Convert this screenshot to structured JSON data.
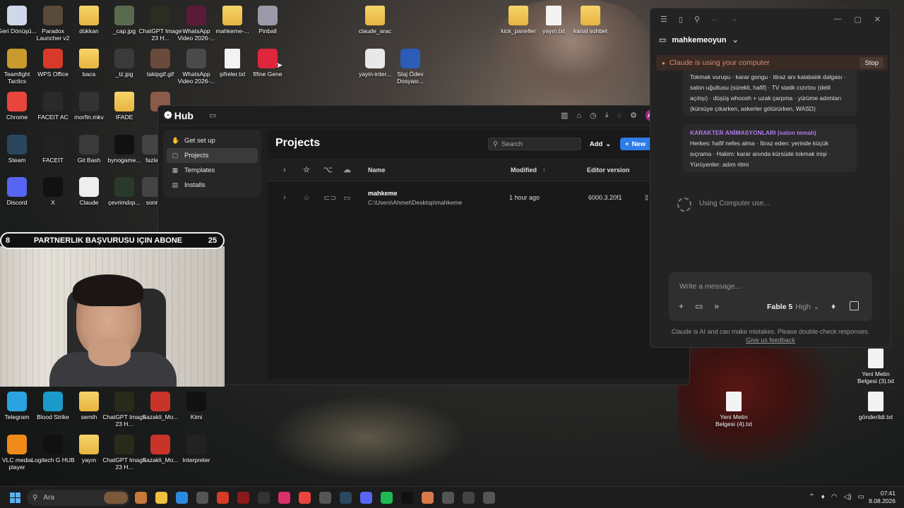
{
  "desktop_icons": [
    {
      "label": "Geri Dönüşü...",
      "icon": "recycle-bin-icon",
      "color": "#cfd8e8"
    },
    {
      "label": "Paradox Launcher v2",
      "icon": "paradox-icon",
      "color": "#5a4a3a"
    },
    {
      "label": "dükkan",
      "icon": "folder-icon",
      "color": "#f0c95a"
    },
    {
      "label": "_cap.jpg",
      "icon": "image-icon",
      "color": "#596b4f"
    },
    {
      "label": "ChatGPT Image 23 H...",
      "icon": "image-icon",
      "color": "#2d2d1f"
    },
    {
      "label": "WhatsApp Video 2026-...",
      "icon": "video-icon",
      "color": "#5a1b3a"
    },
    {
      "label": "mahkeme-...",
      "icon": "folder-icon",
      "color": "#f0c95a"
    },
    {
      "label": "Pinball",
      "icon": "pinball-icon",
      "color": "#9a9aa8"
    },
    {
      "label": "claude_arac",
      "icon": "folder-icon",
      "color": "#f0c95a"
    },
    {
      "label": "kick_paneller",
      "icon": "folder-icon",
      "color": "#f0c95a"
    },
    {
      "label": "yayın.txt",
      "icon": "text-file-icon",
      "color": "#eee"
    },
    {
      "label": "kanal sohbet",
      "icon": "folder-icon",
      "color": "#f0c95a"
    },
    {
      "label": "Teamfight Tactics",
      "icon": "tft-icon",
      "color": "#c89b2c"
    },
    {
      "label": "WPS Office",
      "icon": "wps-icon",
      "color": "#d83a2a"
    },
    {
      "label": "baca",
      "icon": "folder-icon",
      "color": "#f0c95a"
    },
    {
      "label": "_tz.jpg",
      "icon": "image-icon",
      "color": "#3a3a3a"
    },
    {
      "label": "takipgif.gif",
      "icon": "image-icon",
      "color": "#6a4a3a"
    },
    {
      "label": "WhatsApp Video 2026-...",
      "icon": "video-icon",
      "color": "#4a4a4a"
    },
    {
      "label": "şifreler.txt",
      "icon": "text-file-icon",
      "color": "#eee"
    },
    {
      "label": "fifine Gene",
      "icon": "fifine-icon",
      "color": "#e0263c"
    },
    {
      "label": "yayin-inter...",
      "icon": "settings-file-icon",
      "color": "#e8e8e8"
    },
    {
      "label": "Staj Ödev Dosyası...",
      "icon": "word-icon",
      "color": "#2b5cb8"
    },
    {
      "label": "Chrome",
      "icon": "chrome-icon",
      "color": "#e8453c"
    },
    {
      "label": "FACEIT AC",
      "icon": "faceit-icon",
      "color": "#2a2a2a"
    },
    {
      "label": "morfin.mkv",
      "icon": "video-icon",
      "color": "#333"
    },
    {
      "label": "IFADE",
      "icon": "folder-icon",
      "color": "#f0c95a"
    },
    {
      "label": "ke",
      "icon": "image-icon",
      "color": "#8a5a4a"
    },
    {
      "label": "Steam",
      "icon": "steam-icon",
      "color": "#2a475e"
    },
    {
      "label": "FACEIT",
      "icon": "faceit-icon",
      "color": "#222"
    },
    {
      "label": "Git Bash",
      "icon": "git-icon",
      "color": "#3a3a3a"
    },
    {
      "label": "bynogame...",
      "icon": "image-icon",
      "color": "#111"
    },
    {
      "label": "fazla",
      "icon": "image-icon",
      "color": "#444"
    },
    {
      "label": "Discord",
      "icon": "discord-icon",
      "color": "#5865f2"
    },
    {
      "label": "X",
      "icon": "x-icon",
      "color": "#111"
    },
    {
      "label": "Claude",
      "icon": "claude-icon",
      "color": "#eee"
    },
    {
      "label": "çevrimdışı...",
      "icon": "image-icon",
      "color": "#2a3a2a"
    },
    {
      "label": "sonr",
      "icon": "image-icon",
      "color": "#444"
    },
    {
      "label": "Telegram",
      "icon": "telegram-icon",
      "color": "#2aa3e0"
    },
    {
      "label": "Blood Strike",
      "icon": "bloodstrike-icon",
      "color": "#1a9ac8"
    },
    {
      "label": "semih",
      "icon": "folder-icon",
      "color": "#f0c95a"
    },
    {
      "label": "ChatGPT Image 23 H...",
      "icon": "image-icon",
      "color": "#2a2a1a"
    },
    {
      "label": "Sazakli_Mo...",
      "icon": "pdf-icon",
      "color": "#c8342a"
    },
    {
      "label": "Kimi",
      "icon": "kimi-icon",
      "color": "#111"
    },
    {
      "label": "VLC media player",
      "icon": "vlc-icon",
      "color": "#f08a1a"
    },
    {
      "label": "Logitech G HUB",
      "icon": "logitech-icon",
      "color": "#111"
    },
    {
      "label": "yayın",
      "icon": "folder-icon",
      "color": "#f0c95a"
    },
    {
      "label": "ChatGPT Image 23 H...",
      "icon": "image-icon",
      "color": "#2a2a1a"
    },
    {
      "label": "Sazakli_Mo...",
      "icon": "pdf-icon",
      "color": "#c8342a"
    },
    {
      "label": "Interpreter",
      "icon": "interpreter-icon",
      "color": "#222"
    },
    {
      "label": "Yeni Metin Belgesi (4).txt",
      "icon": "text-file-icon",
      "color": "#eee"
    },
    {
      "label": "Yeni Metin Belgesi (3).txt",
      "icon": "text-file-icon",
      "color": "#eee"
    },
    {
      "label": "gönderildi.txt",
      "icon": "text-file-icon",
      "color": "#eee"
    }
  ],
  "stream_banner": {
    "left": "8",
    "text": "PARTNERLIK BAŞVURUSU IÇIN ABONE",
    "right": "25"
  },
  "hub": {
    "logo": "Hub",
    "avatar": "AÖ",
    "sidebar": [
      {
        "label": "Get set up",
        "icon": "hand-wave-icon"
      },
      {
        "label": "Projects",
        "icon": "projects-icon"
      },
      {
        "label": "Templates",
        "icon": "templates-icon"
      },
      {
        "label": "Installs",
        "icon": "installs-icon"
      }
    ],
    "title": "Projects",
    "search_placeholder": "Search",
    "add_label": "Add",
    "new_label": "New",
    "columns": {
      "name": "Name",
      "modified": "Modified",
      "editor": "Editor version"
    },
    "rows": [
      {
        "name": "mahkeme",
        "path": "C:\\Users\\Ahmet\\Desktop\\mahkeme",
        "modified": "1 hour ago",
        "editor": "6000.3.20f1"
      }
    ]
  },
  "claude": {
    "project": "mahkemeoyun",
    "banner": "Claude is using your computer",
    "stop_label": "Stop",
    "msg1": "Tokmak vuruşu · karar gongu · itiraz anı kalabalık dalgası · salon uğultusu (sürekli, hafif) · TV statik cızırtısı (delil açılışı) · düşüş whoosh + uzak çarpma · yürüme adımları (kürsüye çıkarken, askerler götürürken, WASD)",
    "msg2_head": "KARAKTER ANİMASYONLARI (salon temalı)",
    "msg2_body": "Herkes: hafif nefes alma · İtiraz eden: yerinde küçük sıçrama · Hakim: karar anında kürsüde tokmak inişi · Yürüyenler: adım ritmi",
    "status": "Using Computer use...",
    "input_placeholder": "Write a message...",
    "model": "Fable 5",
    "effort": "High",
    "disclaimer": "Claude is AI and can make mistakes. Please double-check responses.",
    "feedback": "Give us feedback"
  },
  "taskbar": {
    "search_placeholder": "Ara",
    "time": "07:41",
    "date": "8.08.2026",
    "apps": [
      {
        "icon": "weather-icon",
        "color": "#c8783a"
      },
      {
        "icon": "file-explorer-icon",
        "color": "#f0c040"
      },
      {
        "icon": "edge-icon",
        "color": "#2b8ae0"
      },
      {
        "icon": "speedometer-icon",
        "color": "#555"
      },
      {
        "icon": "app-red-icon",
        "color": "#d83a2a"
      },
      {
        "icon": "app-dark-red-icon",
        "color": "#8a1a1a"
      },
      {
        "icon": "chatgpt-icon",
        "color": "#333"
      },
      {
        "icon": "instagram-icon",
        "color": "#d8306a"
      },
      {
        "icon": "chrome-icon",
        "color": "#e8453c"
      },
      {
        "icon": "app-gray-icon",
        "color": "#555"
      },
      {
        "icon": "steam-icon",
        "color": "#2a475e"
      },
      {
        "icon": "discord-icon",
        "color": "#5865f2"
      },
      {
        "icon": "spotify-icon",
        "color": "#1db954"
      },
      {
        "icon": "x-icon",
        "color": "#111"
      },
      {
        "icon": "claude-icon",
        "color": "#d87a4a"
      },
      {
        "icon": "compass-icon",
        "color": "#555"
      },
      {
        "icon": "unity-icon",
        "color": "#444"
      },
      {
        "icon": "app-gear-icon",
        "color": "#555"
      }
    ]
  }
}
